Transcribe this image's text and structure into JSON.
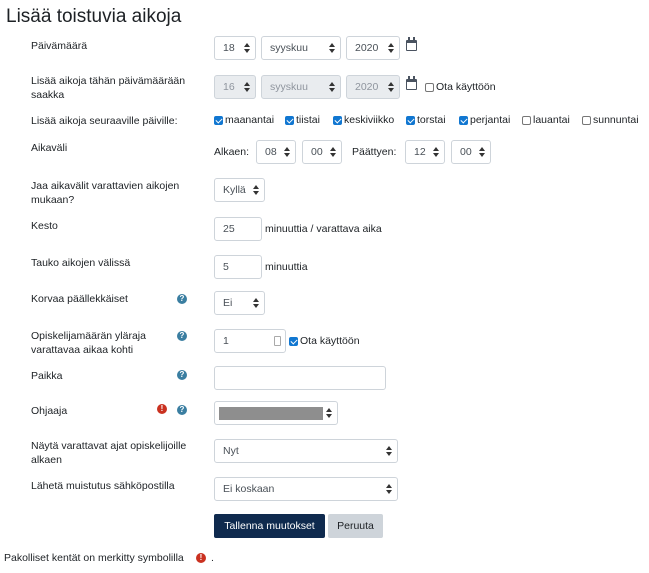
{
  "page_title": "Lisää toistuvia aikoja",
  "date": {
    "label": "Päivämäärä",
    "day": "18",
    "month": "syyskuu",
    "year": "2020"
  },
  "until": {
    "label": "Lisää aikoja tähän päivämäärään saakka",
    "day": "16",
    "month": "syyskuu",
    "year": "2020",
    "enable_label": "Ota käyttöön",
    "enabled": false
  },
  "days": {
    "label": "Lisää aikoja seuraaville päiville:",
    "items": [
      {
        "label": "maanantai",
        "checked": true
      },
      {
        "label": "tiistai",
        "checked": true
      },
      {
        "label": "keskiviikko",
        "checked": true
      },
      {
        "label": "torstai",
        "checked": true
      },
      {
        "label": "perjantai",
        "checked": true
      },
      {
        "label": "lauantai",
        "checked": false
      },
      {
        "label": "sunnuntai",
        "checked": false
      }
    ]
  },
  "timerange": {
    "label": "Aikaväli",
    "start_label": "Alkaen:",
    "start_hour": "08",
    "start_min": "00",
    "end_label": "Päättyen:",
    "end_hour": "12",
    "end_min": "00"
  },
  "divide": {
    "label": "Jaa aikavälit varattavien aikojen mukaan?",
    "value": "Kyllä"
  },
  "duration": {
    "label": "Kesto",
    "value": "25",
    "unit": "minuuttia / varattava aika"
  },
  "break": {
    "label": "Tauko aikojen välissä",
    "value": "5",
    "unit": "minuuttia"
  },
  "overwrite": {
    "label": "Korvaa päällekkäiset",
    "value": "Ei"
  },
  "maxstudents": {
    "label": "Opiskelijamäärän yläraja varattavaa aikaa kohti",
    "value": "1",
    "enable_label": "Ota käyttöön",
    "enabled": true
  },
  "location": {
    "label": "Paikka",
    "value": ""
  },
  "teacher": {
    "label": "Ohjaaja",
    "value": ""
  },
  "displayfrom": {
    "label": "Näytä varattavat ajat opiskelijoille alkaen",
    "value": "Nyt"
  },
  "reminder": {
    "label": "Lähetä muistutus sähköpostilla",
    "value": "Ei koskaan"
  },
  "buttons": {
    "save": "Tallenna muutokset",
    "cancel": "Peruuta"
  },
  "footer": {
    "text": "Pakolliset kentät on merkitty symbolilla",
    "period": "."
  },
  "icons": {
    "help": "?",
    "required": "!"
  },
  "colors": {
    "primary": "#0f2a4e",
    "checkbox": "#1177d1",
    "help": "#3a7ea1",
    "required": "#ca3120"
  }
}
